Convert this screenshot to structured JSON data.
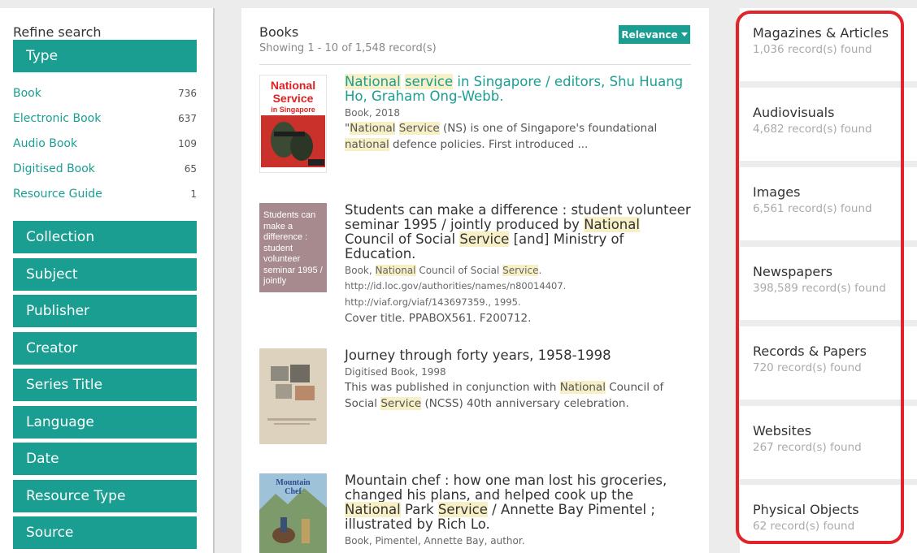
{
  "sidebar": {
    "title": "Refine search",
    "type_header": "Type",
    "types": [
      {
        "label": "Book",
        "count": "736"
      },
      {
        "label": "Electronic Book",
        "count": "637"
      },
      {
        "label": "Audio Book",
        "count": "109"
      },
      {
        "label": "Digitised Book",
        "count": "65"
      },
      {
        "label": "Resource Guide",
        "count": "1"
      }
    ],
    "facets": [
      "Collection",
      "Subject",
      "Publisher",
      "Creator",
      "Series Title",
      "Language",
      "Date",
      "Resource Type",
      "Source"
    ]
  },
  "center": {
    "title": "Books",
    "subtitle": "Showing 1 - 10 of 1,548 record(s)",
    "sort_label": "Relevance",
    "results": [
      {
        "thumb": {
          "line1": "National",
          "line2": "Service",
          "line3": "in Singapore"
        },
        "title_parts": [
          "National",
          " ",
          "service",
          " in Singapore / editors, Shu Huang Ho, Graham Ong-Webb."
        ],
        "meta": "Book, 2018",
        "desc_parts": [
          "\"",
          "National",
          " ",
          "Service",
          " (NS) is one of Singapore's foundational ",
          "national",
          " defence policies. First introduced ..."
        ]
      },
      {
        "thumb": {
          "text": "Students can make a difference : student volunteer seminar 1995 / jointly"
        },
        "title_parts": [
          "Students can make a difference : student volunteer seminar 1995 / jointly produced by ",
          "National",
          " Council of Social ",
          "Service",
          " [and] Ministry of Education."
        ],
        "meta_parts": [
          "Book, ",
          "National",
          " Council of Social ",
          "Service",
          "."
        ],
        "link1": "http://id.loc.gov/authorities/names/n80014407.",
        "link2": "http://viaf.org/viaf/143697359., 1995.",
        "desc": "Cover title. PPABOX561. F200712."
      },
      {
        "title": "Journey through forty years, 1958-1998",
        "meta": "Digitised Book, 1998",
        "desc_parts": [
          "This was published in conjunction with ",
          "National",
          " Council of Social ",
          "Service",
          " (NCSS) 40th anniversary celebration."
        ]
      },
      {
        "thumb": {
          "line1": "Mountain",
          "line2": "Chef"
        },
        "title_parts": [
          "Mountain chef : how one man lost his groceries, changed his plans, and helped cook up the ",
          "National",
          " Park ",
          "Service",
          " / Annette Bay Pimentel ; illustrated by Rich Lo."
        ],
        "meta": "Book, Pimentel, Annette Bay, author."
      }
    ]
  },
  "right": {
    "categories": [
      {
        "name": "Magazines & Articles",
        "count": "1,036 record(s) found"
      },
      {
        "name": "Audiovisuals",
        "count": "4,682 record(s) found"
      },
      {
        "name": "Images",
        "count": "6,561 record(s) found"
      },
      {
        "name": "Newspapers",
        "count": "398,589 record(s) found"
      },
      {
        "name": "Records & Papers",
        "count": "720 record(s) found"
      },
      {
        "name": "Websites",
        "count": "267 record(s) found"
      },
      {
        "name": "Physical Objects",
        "count": "62 record(s) found"
      }
    ]
  },
  "colors": {
    "accent": "#1a9e92",
    "highlight": "#f7efc6",
    "annotation": "#e3232a"
  }
}
